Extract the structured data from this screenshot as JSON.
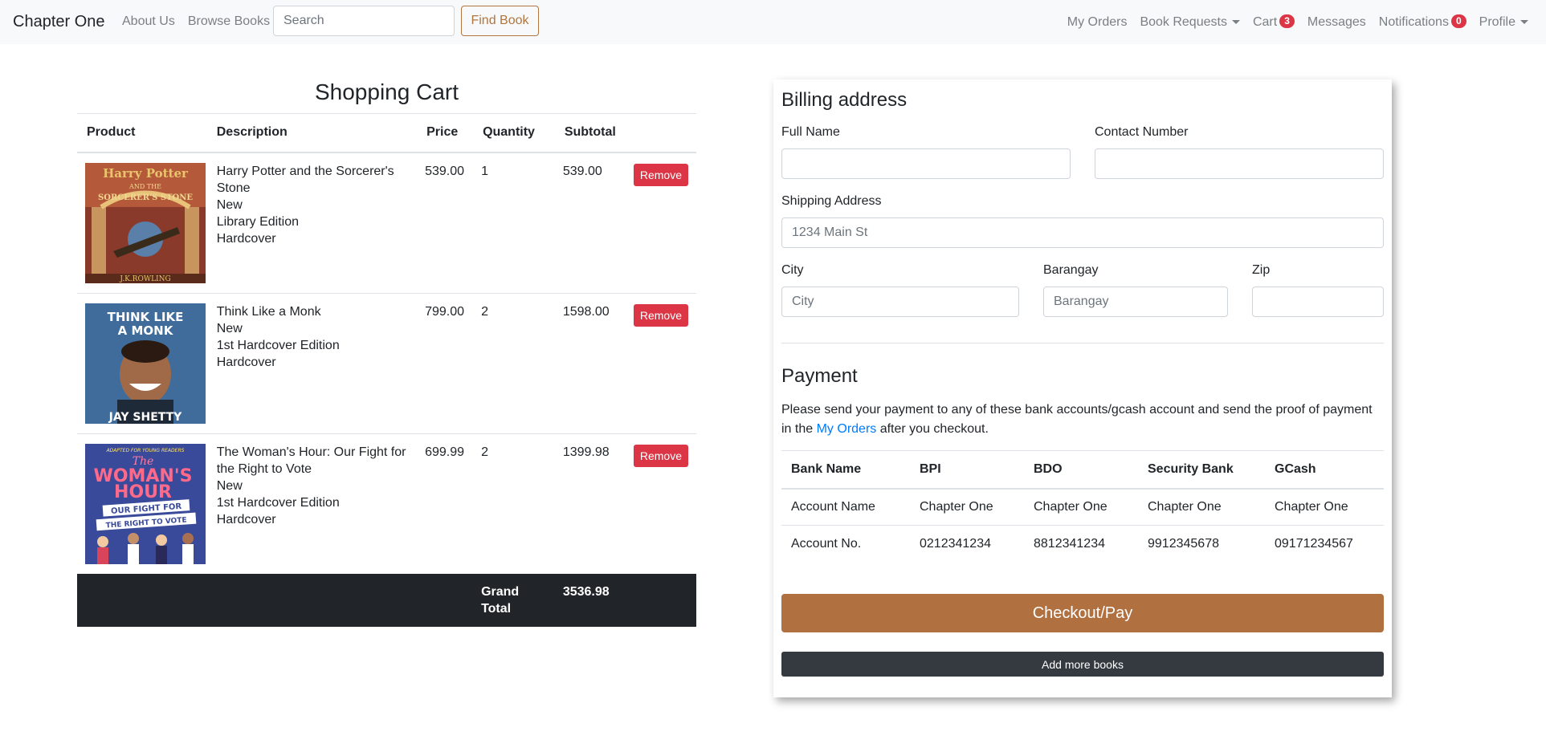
{
  "navbar": {
    "brand": "Chapter One",
    "links_left": [
      "About Us",
      "Browse Books"
    ],
    "search_placeholder": "Search",
    "find_button": "Find Book",
    "my_orders": "My Orders",
    "book_requests": "Book Requests",
    "cart": "Cart",
    "cart_count": "3",
    "messages": "Messages",
    "notifications": "Notifications",
    "notifications_count": "0",
    "profile": "Profile"
  },
  "cart": {
    "title": "Shopping Cart",
    "headers": [
      "Product",
      "Description",
      "Price",
      "Quantity",
      "Subtotal"
    ],
    "remove_label": "Remove",
    "items": [
      {
        "title": "Harry Potter and the Sorcerer's Stone",
        "condition": "New",
        "edition": "Library Edition",
        "format": "Hardcover",
        "price": "539.00",
        "quantity": "1",
        "subtotal": "539.00"
      },
      {
        "title": "Think Like a Monk",
        "condition": "New",
        "edition": "1st Hardcover Edition",
        "format": "Hardcover",
        "price": "799.00",
        "quantity": "2",
        "subtotal": "1598.00"
      },
      {
        "title": "The Woman's Hour: Our Fight for the Right to Vote",
        "condition": "New",
        "edition": "1st Hardcover Edition",
        "format": "Hardcover",
        "price": "699.99",
        "quantity": "2",
        "subtotal": "1399.98"
      }
    ],
    "grand_total_label": "Grand Total",
    "grand_total": "3536.98"
  },
  "covers": {
    "hp": {
      "line1": "Harry Potter",
      "line2": "AND THE",
      "line3": "SORCERER'S STONE",
      "author": "J.K.ROWLING"
    },
    "monk": {
      "line1": "THINK LIKE",
      "line2": "A MONK",
      "author": "JAY SHETTY"
    },
    "woman": {
      "top": "ADAPTED FOR YOUNG READERS",
      "line1": "The",
      "line2": "WOMAN'S",
      "line3": "HOUR",
      "line4": "OUR FIGHT FOR",
      "line5": "THE RIGHT TO VOTE"
    }
  },
  "billing": {
    "title": "Billing address",
    "full_name_label": "Full Name",
    "contact_label": "Contact Number",
    "shipping_label": "Shipping Address",
    "shipping_placeholder": "1234 Main St",
    "city_label": "City",
    "city_placeholder": "City",
    "barangay_label": "Barangay",
    "barangay_placeholder": "Barangay",
    "zip_label": "Zip"
  },
  "payment": {
    "title": "Payment",
    "note_before": "Please send your payment to any of these bank accounts/gcash account and send the proof of payment in the ",
    "note_link": "My Orders",
    "note_after": " after you checkout.",
    "headers": [
      "Bank Name",
      "BPI",
      "BDO",
      "Security Bank",
      "GCash"
    ],
    "rows": [
      [
        "Account Name",
        "Chapter One",
        "Chapter One",
        "Chapter One",
        "Chapter One"
      ],
      [
        "Account No.",
        "0212341234",
        "8812341234",
        "9912345678",
        "09171234567"
      ]
    ],
    "checkout_button": "Checkout/Pay",
    "add_more_button": "Add more books"
  }
}
